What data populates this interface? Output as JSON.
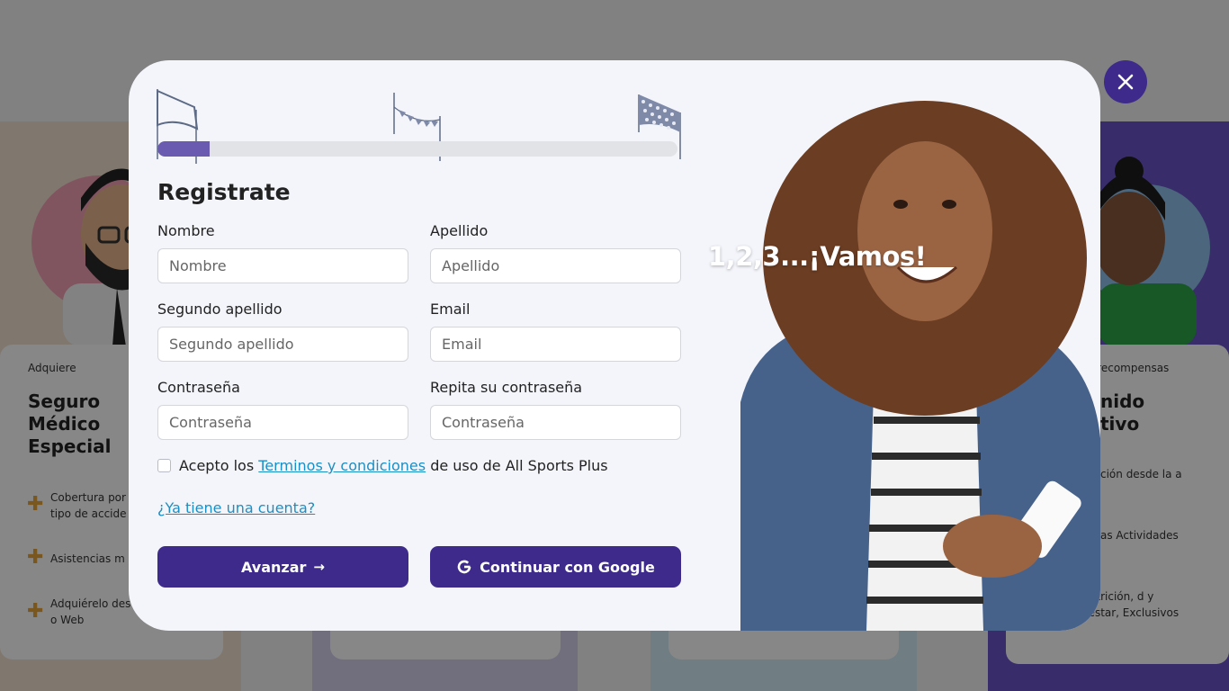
{
  "background": {
    "left_card": {
      "kicker": "Adquiere",
      "title": "Seguro Médico Especial",
      "features": [
        "Cobertura por tipo de accide",
        "Asistencias m",
        "Adquiérelo des o Web"
      ]
    },
    "right_card": {
      "kicker": "a recompensas",
      "title": "nido tivo",
      "features": [
        "ción desde la a",
        "as Actividades",
        "de Nutrición, d y Bienestar, Exclusivos"
      ]
    }
  },
  "modal": {
    "title": "Registrate",
    "progress_fraction": 0.1,
    "fields": {
      "nombre": {
        "label": "Nombre",
        "placeholder": "Nombre"
      },
      "apellido": {
        "label": "Apellido",
        "placeholder": "Apellido"
      },
      "segundo_apellido": {
        "label": "Segundo apellido",
        "placeholder": "Segundo apellido"
      },
      "email": {
        "label": "Email",
        "placeholder": "Email"
      },
      "contrasena": {
        "label": "Contraseña",
        "placeholder": "Contraseña"
      },
      "repita": {
        "label": "Repita su contraseña",
        "placeholder": "Contraseña"
      }
    },
    "terms": {
      "prefix": "Acepto los",
      "link": "Terminos y condiciones",
      "suffix": "de uso de All Sports Plus"
    },
    "account_link": "¿Ya tiene una cuenta?",
    "advance_button": "Avanzar",
    "google_button": "Continuar con Google",
    "hero_text": "1,2,3...¡Vamos!"
  },
  "colors": {
    "brand": "#3d2a8a",
    "progress": "#6b5bb0",
    "link": "#1a8fc4",
    "accent_plus": "#e7a53a"
  },
  "icons": {
    "close": "close-icon",
    "arrow": "arrow-right-icon",
    "google": "google-icon"
  }
}
